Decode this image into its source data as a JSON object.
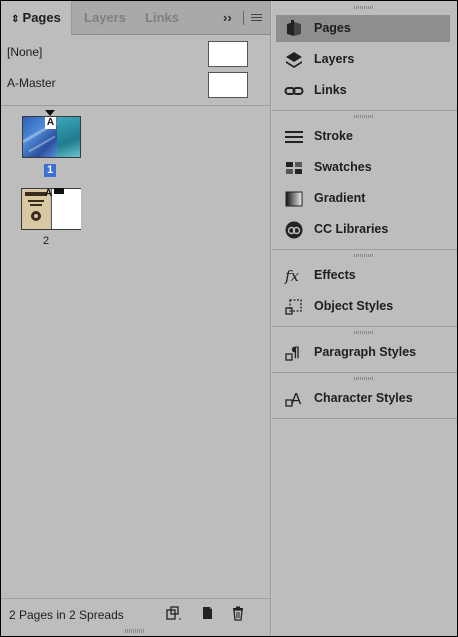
{
  "tabs": [
    {
      "label": "Pages",
      "prefix": "⇕"
    },
    {
      "label": "Layers"
    },
    {
      "label": "Links"
    }
  ],
  "tab_overflow": "››",
  "masters": [
    {
      "label": "[None]"
    },
    {
      "label": "A-Master"
    }
  ],
  "pages": [
    {
      "number": "1",
      "master": "A"
    },
    {
      "number": "2",
      "master": "A"
    }
  ],
  "status": "2 Pages in 2 Spreads",
  "dock_items": [
    {
      "label": "Pages",
      "icon": "pages-icon"
    },
    {
      "label": "Layers",
      "icon": "layers-icon"
    },
    {
      "label": "Links",
      "icon": "links-icon"
    },
    {
      "label": "Stroke",
      "icon": "stroke-icon"
    },
    {
      "label": "Swatches",
      "icon": "swatches-icon"
    },
    {
      "label": "Gradient",
      "icon": "gradient-icon"
    },
    {
      "label": "CC Libraries",
      "icon": "cc-libraries-icon"
    },
    {
      "label": "Effects",
      "icon": "effects-icon"
    },
    {
      "label": "Object Styles",
      "icon": "object-styles-icon"
    },
    {
      "label": "Paragraph Styles",
      "icon": "paragraph-styles-icon"
    },
    {
      "label": "Character Styles",
      "icon": "character-styles-icon"
    }
  ],
  "colors": {
    "selected_page": "#3b6fd3",
    "panel_bg": "#bdbdbd",
    "selected_dock": "#8e8e8e"
  }
}
